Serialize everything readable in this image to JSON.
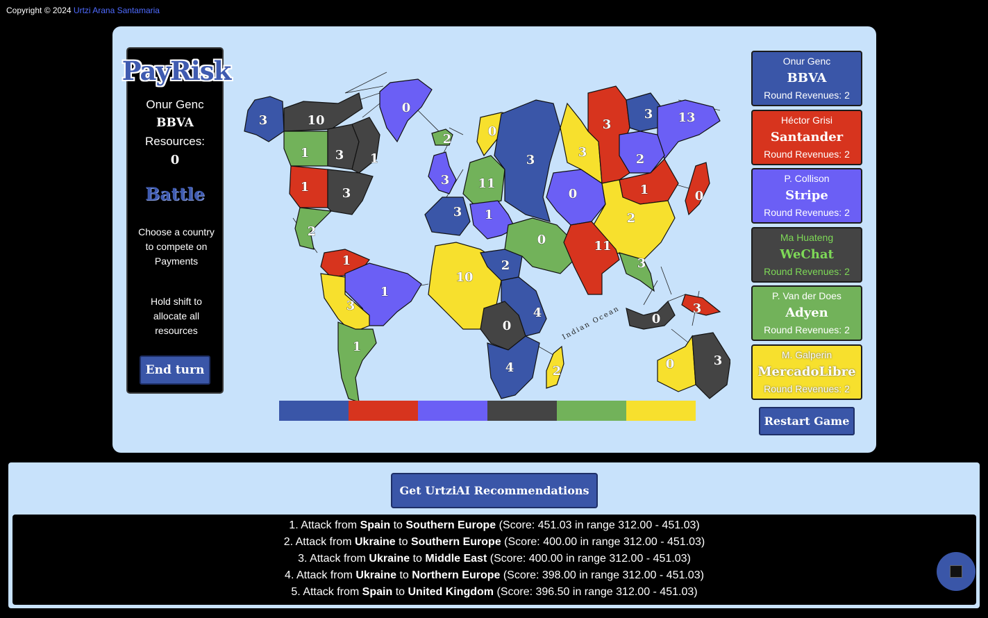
{
  "copyright": {
    "prefix": "Copyright © 2024",
    "author": "Urtzi Arana Santamaria"
  },
  "sidebar": {
    "logo": "PayRisk",
    "player_name": "Onur Genc",
    "player_company": "BBVA",
    "resources_label": "Resources:",
    "resources_value": "0",
    "phase": "Battle",
    "instruction": "Choose a country to compete on Payments",
    "hint": "Hold shift to allocate all resources",
    "end_turn_label": "End turn"
  },
  "map": {
    "ocean_label": "Indian Ocean",
    "territories": [
      {
        "name": "Alaska",
        "owner": "blue",
        "armies": "3"
      },
      {
        "name": "Northwest Territory",
        "owner": "dark",
        "armies": "10"
      },
      {
        "name": "Greenland",
        "owner": "purple",
        "armies": "0"
      },
      {
        "name": "Alberta",
        "owner": "green",
        "armies": "1"
      },
      {
        "name": "Ontario",
        "owner": "dark",
        "armies": "3"
      },
      {
        "name": "Quebec",
        "owner": "dark",
        "armies": "1"
      },
      {
        "name": "Western US",
        "owner": "red",
        "armies": "1"
      },
      {
        "name": "Eastern US",
        "owner": "dark",
        "armies": "3"
      },
      {
        "name": "Central America",
        "owner": "green",
        "armies": "2"
      },
      {
        "name": "Venezuela",
        "owner": "red",
        "armies": "1"
      },
      {
        "name": "Brazil",
        "owner": "purple",
        "armies": "1"
      },
      {
        "name": "Peru",
        "owner": "yellow",
        "armies": "3"
      },
      {
        "name": "Argentina",
        "owner": "green",
        "armies": "1"
      },
      {
        "name": "Iceland",
        "owner": "green",
        "armies": "2"
      },
      {
        "name": "Scandinavia",
        "owner": "yellow",
        "armies": "0"
      },
      {
        "name": "United Kingdom",
        "owner": "purple",
        "armies": "3"
      },
      {
        "name": "Northern Europe",
        "owner": "green",
        "armies": "11"
      },
      {
        "name": "Ukraine",
        "owner": "blue",
        "armies": "3"
      },
      {
        "name": "Spain",
        "owner": "blue",
        "armies": "3"
      },
      {
        "name": "Southern Europe",
        "owner": "purple",
        "armies": "1"
      },
      {
        "name": "North Africa",
        "owner": "yellow",
        "armies": "10"
      },
      {
        "name": "Egypt",
        "owner": "blue",
        "armies": "2"
      },
      {
        "name": "East Africa",
        "owner": "blue",
        "armies": "4"
      },
      {
        "name": "Congo",
        "owner": "dark",
        "armies": "0"
      },
      {
        "name": "South Africa",
        "owner": "blue",
        "armies": "4"
      },
      {
        "name": "Madagascar",
        "owner": "yellow",
        "armies": "2"
      },
      {
        "name": "Middle East",
        "owner": "green",
        "armies": "0"
      },
      {
        "name": "Ural",
        "owner": "yellow",
        "armies": "3"
      },
      {
        "name": "Siberia",
        "owner": "red",
        "armies": "3"
      },
      {
        "name": "Yakutsk",
        "owner": "blue",
        "armies": "3"
      },
      {
        "name": "Kamchatka",
        "owner": "purple",
        "armies": "13"
      },
      {
        "name": "Irkutsk",
        "owner": "purple",
        "armies": "2"
      },
      {
        "name": "Afghanistan",
        "owner": "purple",
        "armies": "0"
      },
      {
        "name": "Mongolia",
        "owner": "red",
        "armies": "1"
      },
      {
        "name": "Japan",
        "owner": "red",
        "armies": "0"
      },
      {
        "name": "China",
        "owner": "yellow",
        "armies": "2"
      },
      {
        "name": "India",
        "owner": "red",
        "armies": "11"
      },
      {
        "name": "Siam",
        "owner": "green",
        "armies": "3"
      },
      {
        "name": "Indonesia",
        "owner": "dark",
        "armies": "0"
      },
      {
        "name": "New Guinea",
        "owner": "red",
        "armies": "3"
      },
      {
        "name": "Western Australia",
        "owner": "yellow",
        "armies": "0"
      },
      {
        "name": "Eastern Australia",
        "owner": "dark",
        "armies": "3"
      }
    ]
  },
  "colors": {
    "blue": "#3a56a8",
    "red": "#d7341e",
    "purple": "#6b5ff5",
    "dark": "#444444",
    "green": "#72b25a",
    "yellow": "#f7e02d"
  },
  "color_bar": [
    "#3a56a8",
    "#d7341e",
    "#6b5ff5",
    "#444444",
    "#72b25a",
    "#f7e02d"
  ],
  "players": [
    {
      "name": "Onur Genc",
      "company": "BBVA",
      "revenue": "Round Revenues: 2",
      "bg": "#3a56a8",
      "fg": "#ffffff"
    },
    {
      "name": "Héctor Grisi",
      "company": "Santander",
      "revenue": "Round Revenues: 2",
      "bg": "#d7341e",
      "fg": "#ffffff"
    },
    {
      "name": "P. Collison",
      "company": "Stripe",
      "revenue": "Round Revenues: 2",
      "bg": "#6b5ff5",
      "fg": "#ffffff"
    },
    {
      "name": "Ma Huateng",
      "company": "WeChat",
      "revenue": "Round Revenues: 2",
      "bg": "#444444",
      "fg": "#7ed957"
    },
    {
      "name": "P. Van der Does",
      "company": "Adyen",
      "revenue": "Round Revenues: 2",
      "bg": "#72b25a",
      "fg": "#ffffff"
    },
    {
      "name": "M. Galperin",
      "company": "MercadoLibre",
      "revenue": "Round Revenues: 2",
      "bg": "#f7e02d",
      "fg": "#ffffff"
    }
  ],
  "restart_label": "Restart Game",
  "ai": {
    "button_label": "Get UrtziAI Recommendations",
    "recommendations": [
      {
        "index": "1.",
        "from": "Spain",
        "to": "Southern Europe",
        "score": "(Score: 451.03 in range 312.00 - 451.03)"
      },
      {
        "index": "2.",
        "from": "Ukraine",
        "to": "Southern Europe",
        "score": "(Score: 400.00 in range 312.00 - 451.03)"
      },
      {
        "index": "3.",
        "from": "Ukraine",
        "to": "Middle East",
        "score": "(Score: 400.00 in range 312.00 - 451.03)"
      },
      {
        "index": "4.",
        "from": "Ukraine",
        "to": "Northern Europe",
        "score": "(Score: 398.00 in range 312.00 - 451.03)"
      },
      {
        "index": "5.",
        "from": "Spain",
        "to": "United Kingdom",
        "score": "(Score: 396.50 in range 312.00 - 451.03)"
      }
    ],
    "attack_word": "Attack from",
    "to_word": "to"
  }
}
